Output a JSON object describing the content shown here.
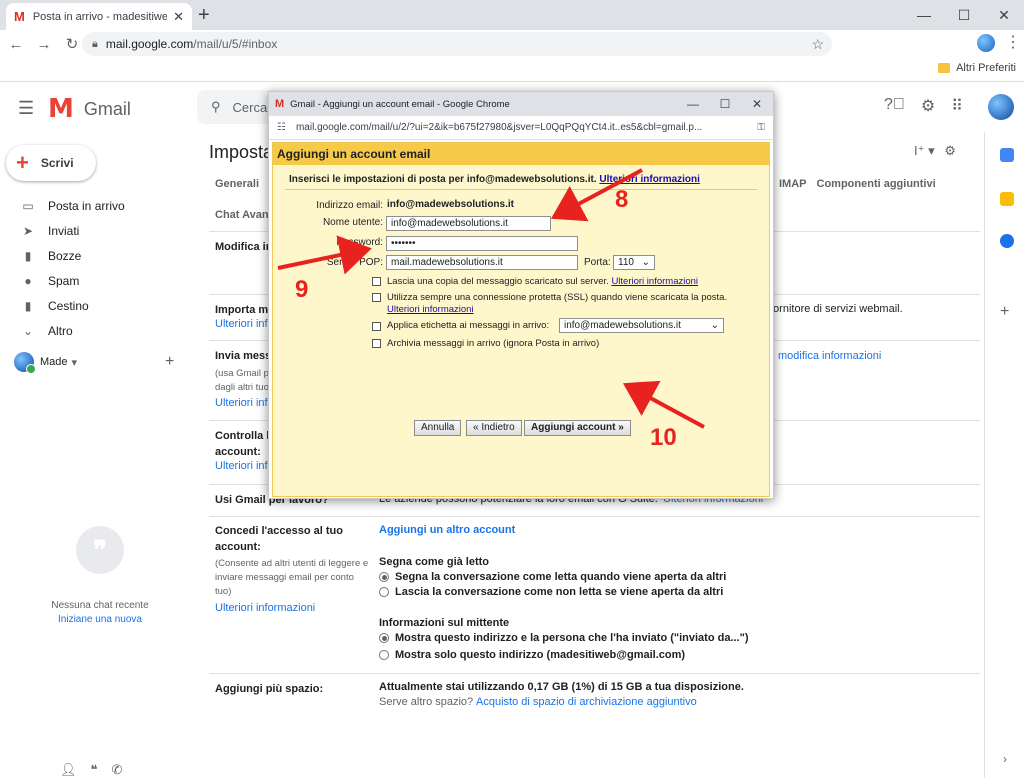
{
  "browser": {
    "tab_title": "Posta in arrivo - madesitiweb@gmail.com",
    "url_host": "mail.google.com",
    "url_path": "/mail/u/5/#inbox",
    "bookmark_folder": "Altri Preferiti",
    "win_minimize": "—",
    "win_maximize": "☐",
    "win_close": "✕"
  },
  "gmail": {
    "app_name": "Gmail",
    "search_placeholder": "Cerca",
    "compose_label": "Scrivi",
    "nav": [
      {
        "label": "Posta in arrivo",
        "icon": "inbox-icon"
      },
      {
        "label": "Inviati",
        "icon": "send-icon"
      },
      {
        "label": "Bozze",
        "icon": "draft-icon"
      },
      {
        "label": "Spam",
        "icon": "spam-icon"
      },
      {
        "label": "Cestino",
        "icon": "trash-icon"
      },
      {
        "label": "Altro",
        "icon": "chevron-down-icon"
      }
    ],
    "account_label": "Made",
    "no_chat": "Nessuna chat recente",
    "start_new": "Iniziane una nuova"
  },
  "settings": {
    "title": "Impostazioni",
    "tabs_left": "Generali",
    "tabs_right": [
      "IMAP",
      "Componenti aggiuntivi"
    ],
    "tabs_row2": "Chat   Avanzate",
    "rows": {
      "modifica": "Modifica impostazioni account:",
      "importa": "Importa messaggi e contatti:",
      "importa_link": "Ulteriori informazioni",
      "importa_right": "fornitore di servizi webmail.",
      "invia": "Invia messaggi come:",
      "invia_sub1": "(usa Gmail per inviare messaggi",
      "invia_sub2": "dagli altri tuoi indirizzi email)",
      "invia_link": "Ulteriori informazioni",
      "invia_right": "modifica informazioni",
      "controlla": "Controlla la posta da altri",
      "controlla2": "account:",
      "controlla_link": "Ulteriori informazioni",
      "usi": "Usi Gmail per lavoro?",
      "usi_right": "Le aziende possono potenziare la loro email con G Suite.",
      "usi_link": "Ulteriori informazioni",
      "concedi": "Concedi l'accesso al tuo",
      "concedi2": "account:",
      "concedi_sub1": "(Consente ad altri utenti di leggere e",
      "concedi_sub2": "inviare messaggi email per conto",
      "concedi_sub3": "tuo)",
      "concedi_link": "Ulteriori informazioni",
      "add_account": "Aggiungi un altro account",
      "segna": "Segna come già letto",
      "segna_opt1": "Segna la conversazione come letta quando viene aperta da altri",
      "segna_opt2": "Lascia la conversazione come non letta se viene aperta da altri",
      "mittente": "Informazioni sul mittente",
      "mittente_opt1": "Mostra questo indirizzo e la persona che l'ha inviato (\"inviato da...\")",
      "mittente_opt2": "Mostra solo questo indirizzo (madesitiweb@gmail.com)",
      "spazio": "Aggiungi più spazio:",
      "spazio_val": "Attualmente stai utilizzando 0,17 GB (1%) di 15 GB a tua disposizione.",
      "spazio_q": "Serve altro spazio?",
      "spazio_link": "Acquisto di spazio di archiviazione aggiuntivo"
    }
  },
  "popup": {
    "window_title": "Gmail - Aggiungi un account email - Google Chrome",
    "url": "mail.google.com/mail/u/2/?ui=2&ik=b675f27980&jsver=L0QqPQqYCt4.it..es5&cbl=gmail.p...",
    "heading": "Aggiungi un account email",
    "intro": "Inserisci le impostazioni di posta per info@madewebsolutions.it.",
    "intro_link": "Ulteriori informazioni",
    "email_label": "Indirizzo email:",
    "email_value": "info@madewebsolutions.it",
    "user_label": "Nome utente:",
    "user_value": "info@madewebsolutions.it",
    "pass_label": "Password:",
    "pass_value": "•••••••",
    "pop_label": "Server POP:",
    "pop_value": "mail.madewebsolutions.it",
    "port_label": "Porta:",
    "port_value": "110",
    "opt_copy": "Lascia una copia del messaggio scaricato sul server.",
    "opt_copy_link": "Ulteriori informazioni",
    "opt_ssl": "Utilizza sempre una connessione protetta (SSL) quando viene scaricata la posta.",
    "opt_ssl_link": "Ulteriori informazioni",
    "opt_label": "Applica etichetta ai messaggi in arrivo:",
    "opt_label_value": "info@madewebsolutions.it",
    "opt_archive": "Archivia messaggi in arrivo (ignora Posta in arrivo)",
    "btn_cancel": "Annulla",
    "btn_back": "« Indietro",
    "btn_add": "Aggiungi account »"
  },
  "annotations": {
    "step8": "8",
    "step9": "9",
    "step10": "10",
    "arrow_color": "#e8231f"
  }
}
